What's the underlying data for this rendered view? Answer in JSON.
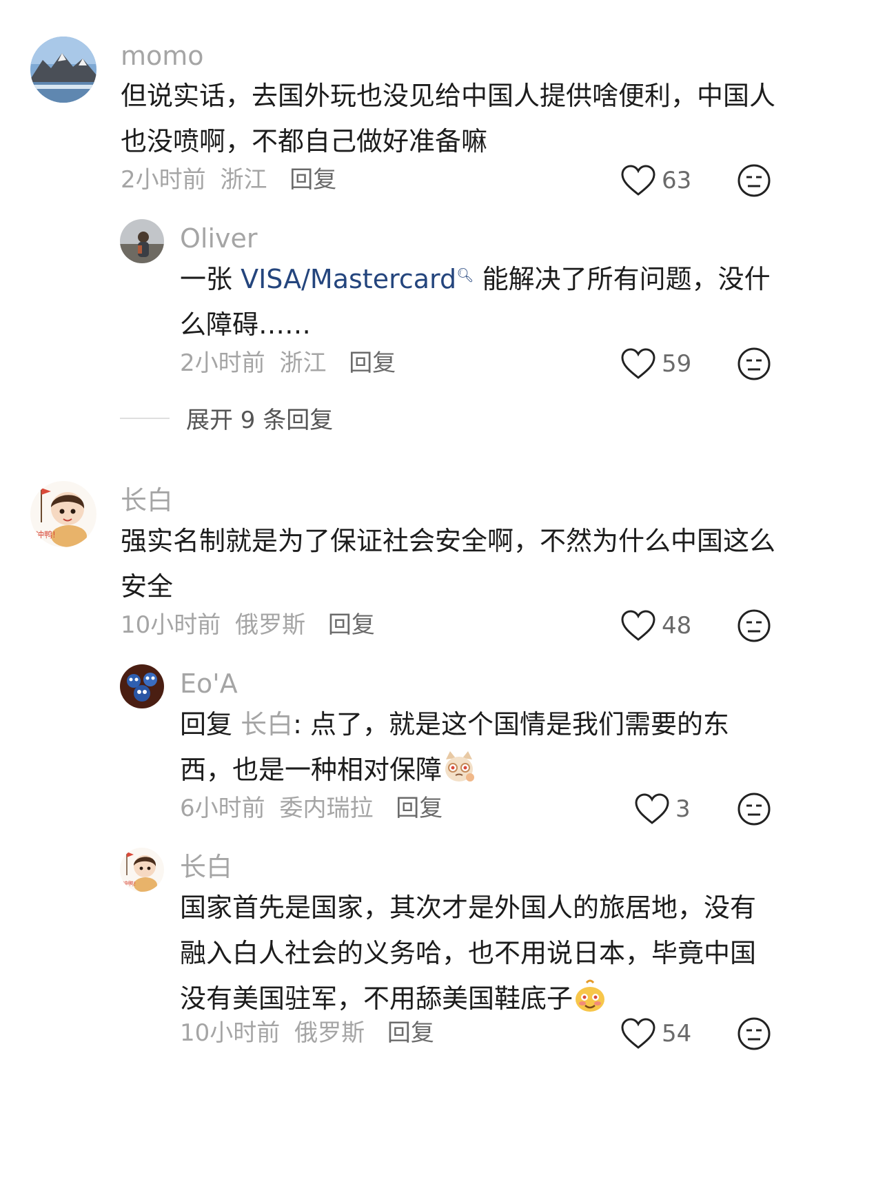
{
  "comments": [
    {
      "username": "momo",
      "text": "但说实话，去国外玩也没见给中国人提供啥便利，中国人也没喷啊，不都自己做好准备嘛",
      "time": "2小时前",
      "location": "浙江",
      "reply_label": "回复",
      "likes": "63",
      "replies": [
        {
          "username": "Oliver",
          "text_before": "一张 ",
          "link": "VISA/Mastercard",
          "link_icon": "search-icon",
          "text_after": " 能解决了所有问题，没什么障碍……",
          "time": "2小时前",
          "location": "浙江",
          "reply_label": "回复",
          "likes": "59"
        }
      ],
      "expand_label": "展开 9 条回复"
    },
    {
      "username": "长白",
      "text": "强实名制就是为了保证社会安全啊，不然为什么中国这么安全",
      "time": "10小时前",
      "location": "俄罗斯",
      "reply_label": "回复",
      "likes": "48",
      "replies": [
        {
          "username": "Eo'A",
          "reply_prefix": "回复 ",
          "mention": "长白",
          "text": ": 点了，就是这个国情是我们需要的东西，也是一种相对保障",
          "emoji": "cat-emoji",
          "time": "6小时前",
          "location": "委内瑞拉",
          "reply_label": "回复",
          "likes": "3"
        },
        {
          "username": "长白",
          "text": "国家首先是国家，其次才是外国人的旅居地，没有融入白人社会的义务哈，也不用说日本，毕竟中国没有美国驻军，不用舔美国鞋底子",
          "emoji": "smirk-emoji",
          "time": "10小时前",
          "location": "俄罗斯",
          "reply_label": "回复",
          "likes": "54"
        }
      ]
    }
  ]
}
